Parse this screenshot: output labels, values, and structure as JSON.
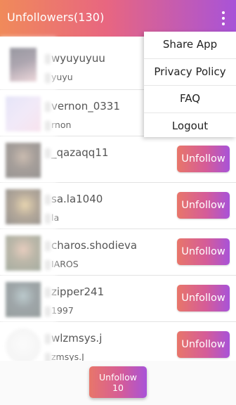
{
  "appbar": {
    "title": "Unfollowers(130)"
  },
  "menu": {
    "items": [
      "Share App",
      "Privacy Policy",
      "FAQ",
      "Logout"
    ]
  },
  "users": [
    {
      "username": "wyuyuyuu",
      "subtitle": "yuyu",
      "avatar": [
        "#1b1b2e",
        "#d8a8b0"
      ],
      "has_button": false
    },
    {
      "username": "vernon_0331",
      "subtitle": "rnon",
      "avatar": [
        "#c6c4ee",
        "#efc0d8"
      ],
      "has_button": false
    },
    {
      "username": "_qazaqq11",
      "subtitle": "",
      "avatar": [
        "#1a1410",
        "#8a6a50"
      ],
      "has_button": true
    },
    {
      "username": "sa.la1040",
      "subtitle": "la",
      "avatar": [
        "#1a120a",
        "#c8a050"
      ],
      "has_button": true
    },
    {
      "username": "charos.shodieva",
      "subtitle": "IAROS",
      "avatar": [
        "#3a4a30",
        "#c89070"
      ],
      "has_button": true
    },
    {
      "username": "zipper241",
      "subtitle": "1997",
      "avatar": [
        "#1a2a2a",
        "#6a8a90"
      ],
      "has_button": true
    },
    {
      "username": "wlzmsys.j",
      "subtitle": "zmsys.J",
      "avatar": [
        "#e8e8e8",
        "#f6f6f6"
      ],
      "has_button": true
    }
  ],
  "unfollow_label": "Unfollow",
  "bottom_button": {
    "label": "Unfollow 10"
  }
}
